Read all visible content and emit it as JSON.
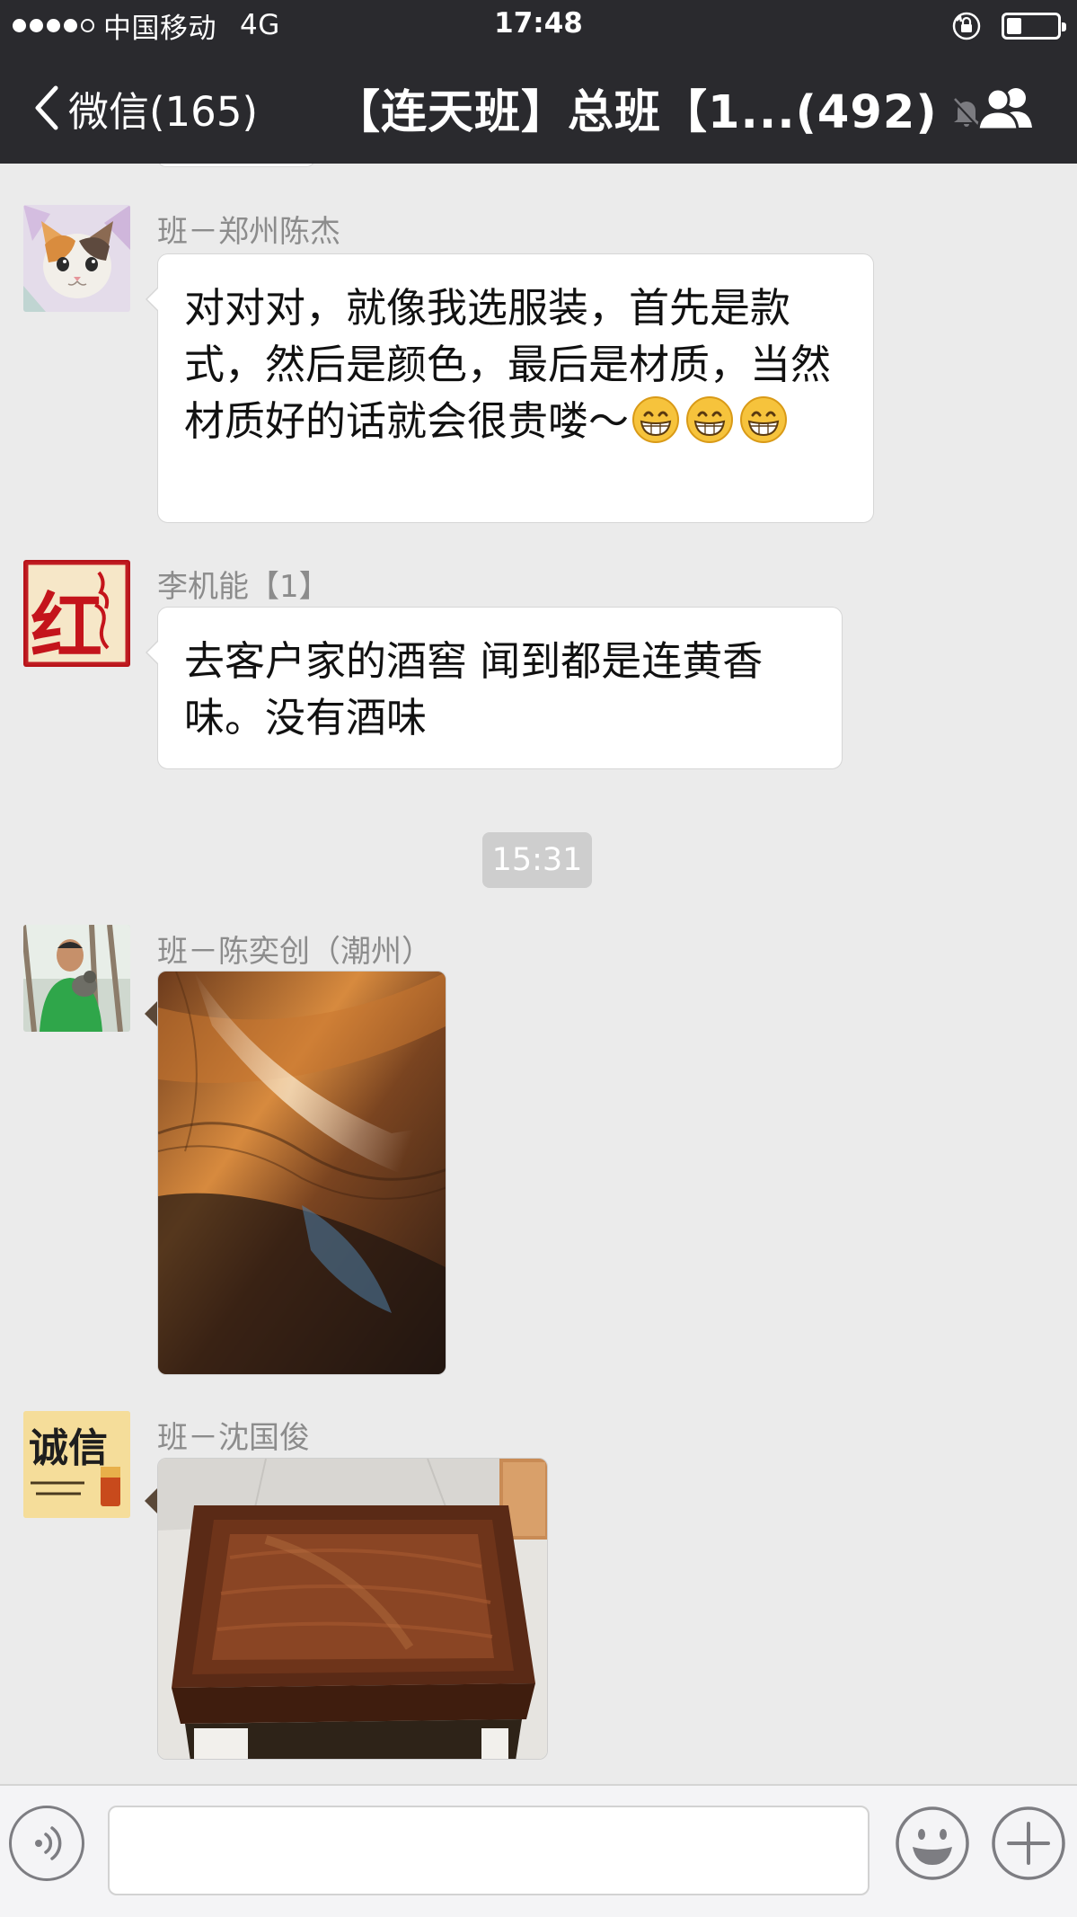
{
  "status_bar": {
    "carrier": "中国移动",
    "network": "4G",
    "time": "17:48",
    "battery_level": 0.3
  },
  "nav": {
    "back_label": "微信(165)",
    "title": "【连天班】总班【1...(492)"
  },
  "messages": [
    {
      "sender": "班－郑州陈杰",
      "text": "对对对，就像我选服装，首先是款式，然后是颜色，最后是材质，当然材质好的话就会很贵喽～",
      "emoji": [
        "grin-emoji",
        "grin-emoji",
        "grin-emoji"
      ]
    },
    {
      "sender": "李机能【1】",
      "text": "去客户家的酒窖 闻到都是连黄香味。没有酒味",
      "avatar_text": "红"
    },
    {
      "sender": "班－陈奕创（潮州）",
      "image": "wood-grain-photo"
    },
    {
      "sender": "班－沈国俊",
      "image": "rosewood-tray-photo",
      "avatar_text": "诚信"
    }
  ],
  "time_divider": "15:31",
  "colors": {
    "header_bg": "#2a2a2e",
    "chat_bg": "#ebebeb",
    "bubble_bg": "#ffffff",
    "name_color": "#8c8c8c"
  },
  "input": {
    "placeholder": ""
  }
}
